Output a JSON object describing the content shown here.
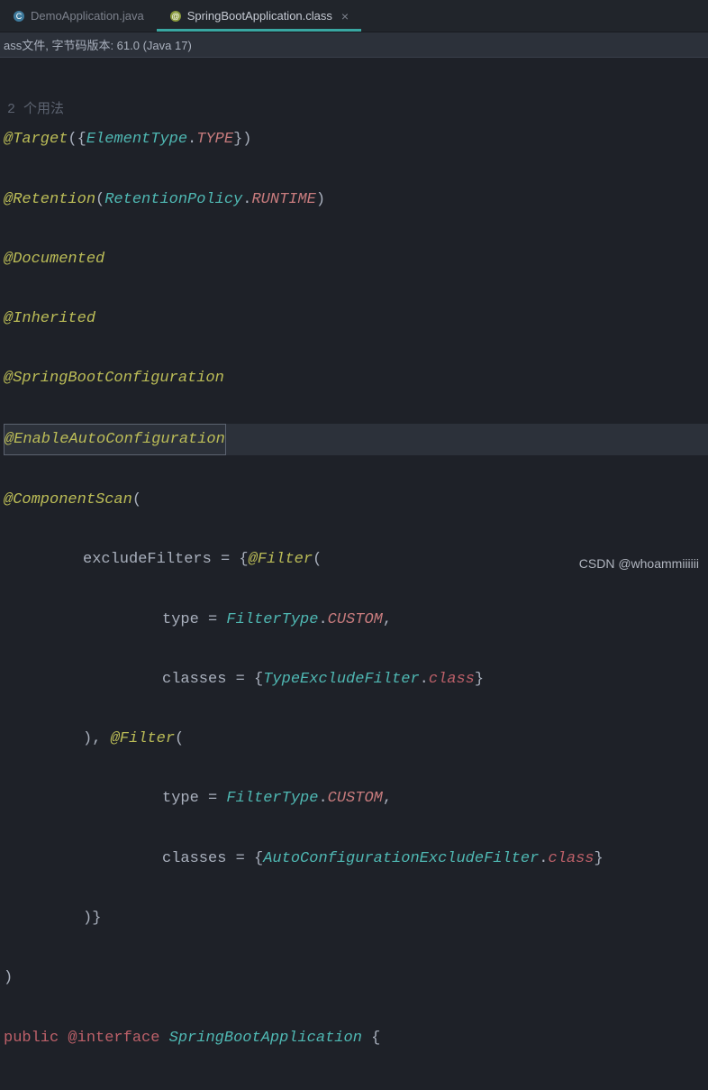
{
  "tabs": [
    {
      "label": "DemoApplication.java",
      "active": false
    },
    {
      "label": "SpringBootApplication.class",
      "active": true
    }
  ],
  "infoBar": "ass文件, 字节码版本: 61.0 (Java 17)",
  "usageHint": "2 个用法",
  "code": {
    "target": {
      "ann": "@Target",
      "type": "ElementType",
      "field": "TYPE"
    },
    "retention": {
      "ann": "@Retention",
      "type": "RetentionPolicy",
      "field": "RUNTIME"
    },
    "documented": "@Documented",
    "inherited": "@Inherited",
    "sbc": "@SpringBootConfiguration",
    "eac": "@EnableAutoConfiguration",
    "componentScan": "@ComponentScan",
    "excludeFilters": "excludeFilters",
    "filter": "@Filter",
    "typeField": "type",
    "filterType": "FilterType",
    "custom": "CUSTOM",
    "classesField": "classes",
    "typeExcludeFilter": "TypeExcludeFilter",
    "autoConfigExcludeFilter": "AutoConfigurationExcludeFilter",
    "classKw": "class",
    "publicKw": "public",
    "interfaceKw": "@interface",
    "className": "SpringBootApplication"
  },
  "watermark": "CSDN @whoammiiiiii"
}
